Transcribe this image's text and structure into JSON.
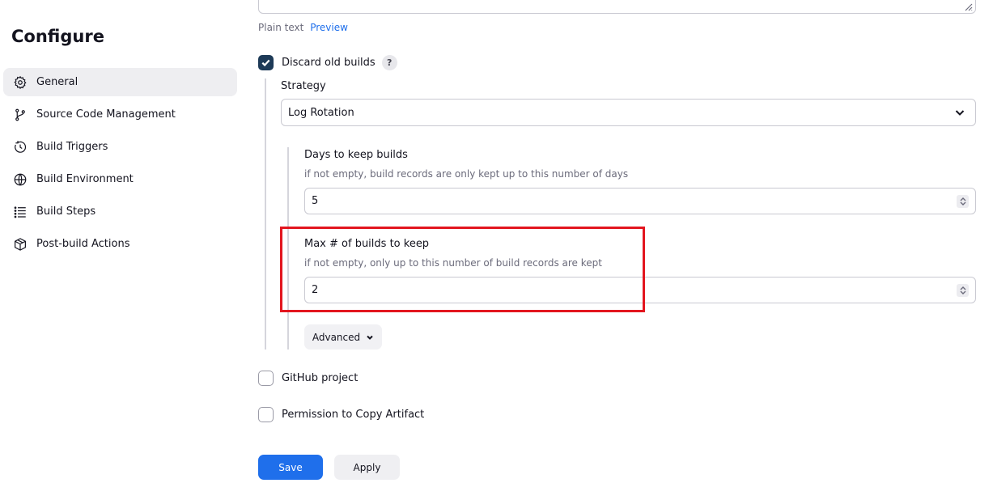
{
  "sidebar": {
    "title": "Configure",
    "items": [
      {
        "label": "General",
        "icon": "gear-icon",
        "active": true
      },
      {
        "label": "Source Code Management",
        "icon": "branch-icon",
        "active": false
      },
      {
        "label": "Build Triggers",
        "icon": "clock-icon",
        "active": false
      },
      {
        "label": "Build Environment",
        "icon": "globe-icon",
        "active": false
      },
      {
        "label": "Build Steps",
        "icon": "list-icon",
        "active": false
      },
      {
        "label": "Post-build Actions",
        "icon": "package-icon",
        "active": false
      }
    ]
  },
  "description": {
    "plain_text": "Plain text",
    "preview": "Preview"
  },
  "discard_old_builds": {
    "label": "Discard old builds",
    "checked": true,
    "help": "?",
    "strategy_label": "Strategy",
    "strategy_value": "Log Rotation",
    "days_label": "Days to keep builds",
    "days_desc": "if not empty, build records are only kept up to this number of days",
    "days_value": "5",
    "max_label": "Max # of builds to keep",
    "max_desc": "if not empty, only up to this number of build records are kept",
    "max_value": "2",
    "advanced": "Advanced"
  },
  "options": [
    {
      "label": "GitHub project",
      "checked": false
    },
    {
      "label": "Permission to Copy Artifact",
      "checked": false
    }
  ],
  "footer": {
    "save": "Save",
    "apply": "Apply"
  },
  "colors": {
    "accent": "#1f6feb",
    "checkbox_checked": "#1d3a57",
    "highlight": "#e3161f"
  }
}
